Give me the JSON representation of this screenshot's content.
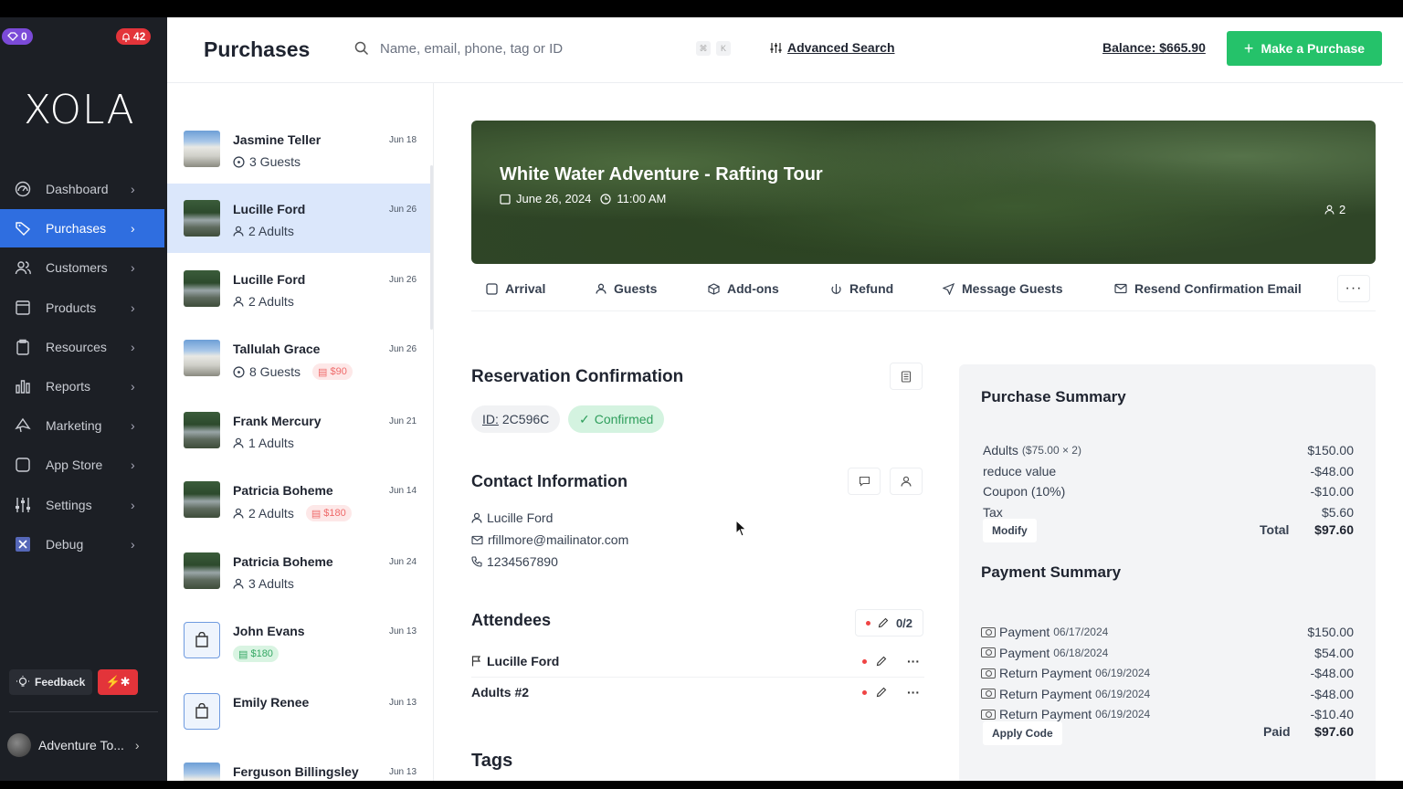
{
  "sidebar": {
    "notif_count": "0",
    "alert_count": "42",
    "logo": "XOLA",
    "items": [
      {
        "label": "Dashboard",
        "icon": "dashboard-icon"
      },
      {
        "label": "Purchases",
        "icon": "tag-icon",
        "active": true
      },
      {
        "label": "Customers",
        "icon": "users-icon"
      },
      {
        "label": "Products",
        "icon": "box-icon"
      },
      {
        "label": "Resources",
        "icon": "clipboard-icon"
      },
      {
        "label": "Reports",
        "icon": "bar-chart-icon"
      },
      {
        "label": "Marketing",
        "icon": "megaphone-icon"
      },
      {
        "label": "App Store",
        "icon": "square-icon"
      },
      {
        "label": "Settings",
        "icon": "sliders-icon"
      },
      {
        "label": "Debug",
        "icon": "x-box-icon"
      }
    ],
    "feedback_label": "Feedback",
    "account_label": "Adventure To..."
  },
  "topbar": {
    "title": "Purchases",
    "search_placeholder": "Name, email, phone, tag or ID",
    "kbd1": "⌘",
    "kbd2": "K",
    "advanced_search": "Advanced Search",
    "balance": "Balance: $665.90",
    "make_purchase": "Make a Purchase"
  },
  "purchases": [
    {
      "name": "Jasmine Teller",
      "sub": "3 Guests",
      "sub_icon": "clock",
      "date": "Jun 18",
      "thumb": "build"
    },
    {
      "name": "Lucille Ford",
      "sub": "2 Adults",
      "sub_icon": "person",
      "date": "Jun 26",
      "thumb": "river",
      "selected": true
    },
    {
      "name": "Lucille Ford",
      "sub": "2 Adults",
      "sub_icon": "person",
      "date": "Jun 26",
      "thumb": "river"
    },
    {
      "name": "Tallulah Grace",
      "sub": "8 Guests",
      "sub_icon": "clock",
      "date": "Jun 26",
      "thumb": "build",
      "tag": "$90",
      "tag_color": "red"
    },
    {
      "name": "Frank Mercury",
      "sub": "1 Adults",
      "sub_icon": "person",
      "date": "Jun 21",
      "thumb": "river"
    },
    {
      "name": "Patricia Boheme",
      "sub": "2 Adults",
      "sub_icon": "person",
      "date": "Jun 14",
      "thumb": "river",
      "tag": "$180",
      "tag_color": "red"
    },
    {
      "name": "Patricia Boheme",
      "sub": "3 Adults",
      "sub_icon": "person",
      "date": "Jun 24",
      "thumb": "river"
    },
    {
      "name": "John Evans",
      "sub": "",
      "date": "Jun 13",
      "thumb": "bag",
      "tag": "$180",
      "tag_color": "green"
    },
    {
      "name": "Emily Renee",
      "sub": "",
      "date": "Jun 13",
      "thumb": "bag"
    },
    {
      "name": "Ferguson Billingsley",
      "sub": "",
      "date": "Jun 13",
      "thumb": "build"
    }
  ],
  "hero": {
    "title": "White Water Adventure - Rafting Tour",
    "date": "June 26, 2024",
    "time": "11:00 AM",
    "guests": "2"
  },
  "actions": [
    "Arrival",
    "Guests",
    "Add-ons",
    "Refund",
    "Message Guests",
    "Resend Confirmation Email"
  ],
  "reservation": {
    "heading": "Reservation Confirmation",
    "id_label": "ID:",
    "id_value": "2C596C",
    "status": "Confirmed"
  },
  "contact": {
    "heading": "Contact Information",
    "name": "Lucille Ford",
    "email": "rfillmore@mailinator.com",
    "phone": "1234567890"
  },
  "attendees": {
    "heading": "Attendees",
    "count": "0/2",
    "list": [
      "Lucille Ford",
      "Adults #2"
    ]
  },
  "tags_heading": "Tags",
  "purchase_summary": {
    "heading": "Purchase Summary",
    "lines": [
      {
        "label": "Adults",
        "detail": "($75.00 × 2)",
        "value": "$150.00"
      },
      {
        "label": "reduce value",
        "detail": "",
        "value": "-$48.00"
      },
      {
        "label": "Coupon (10%)",
        "detail": "",
        "value": "-$10.00"
      },
      {
        "label": "Tax",
        "detail": "",
        "value": "$5.60"
      }
    ],
    "modify_label": "Modify",
    "total_label": "Total",
    "total_value": "$97.60"
  },
  "payment_summary": {
    "heading": "Payment Summary",
    "lines": [
      {
        "label": "Payment",
        "date": "06/17/2024",
        "value": "$150.00"
      },
      {
        "label": "Payment",
        "date": "06/18/2024",
        "value": "$54.00"
      },
      {
        "label": "Return Payment",
        "date": "06/19/2024",
        "value": "-$48.00"
      },
      {
        "label": "Return Payment",
        "date": "06/19/2024",
        "value": "-$48.00"
      },
      {
        "label": "Return Payment",
        "date": "06/19/2024",
        "value": "-$10.40"
      }
    ],
    "apply_code_label": "Apply Code",
    "paid_label": "Paid",
    "paid_value": "$97.60"
  },
  "colors": {
    "accent": "#2f6ee0",
    "success": "#25c26a",
    "sidebar": "#1c1f25"
  }
}
